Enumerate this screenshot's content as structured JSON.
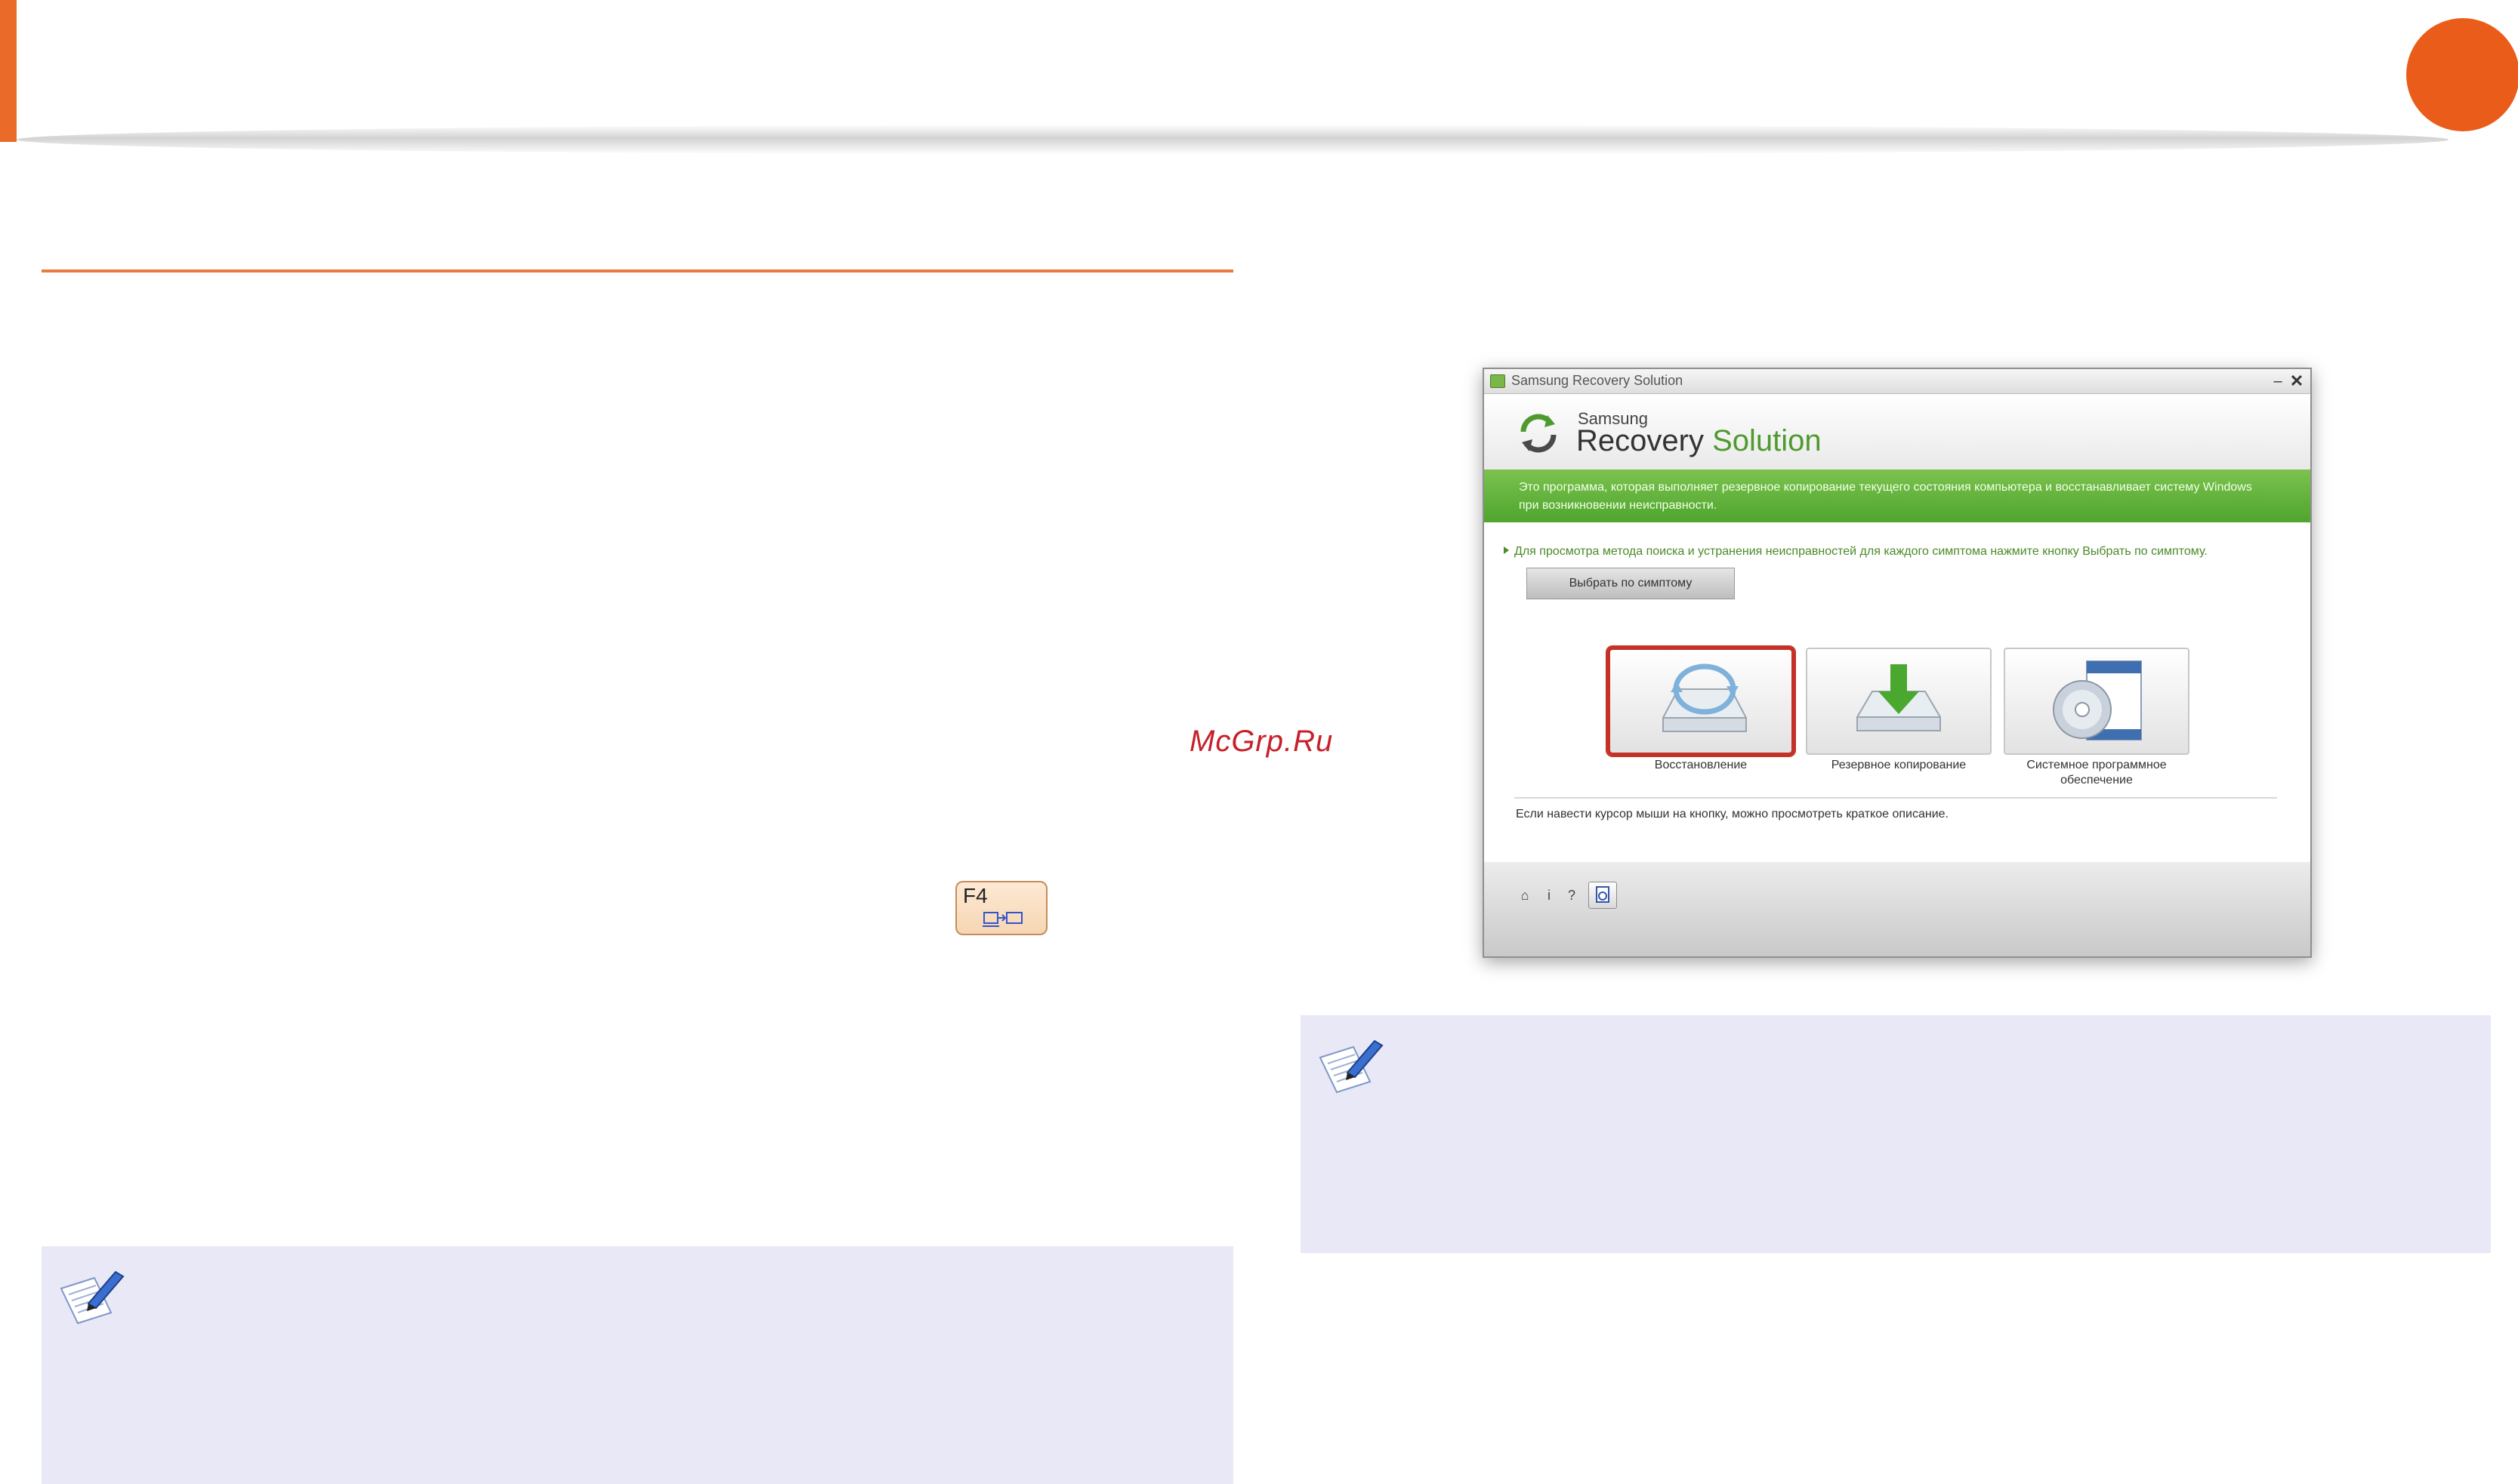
{
  "watermark": "McGrp.Ru",
  "f4_key": {
    "label": "F4"
  },
  "window": {
    "title": "Samsung Recovery Solution",
    "brand_small": "Samsung",
    "brand_word1": "Recovery",
    "brand_word2": "Solution",
    "intro": "Это программа, которая выполняет резервное копирование текущего состояния компьютера и восстанавливает систему Windows при возникновении неисправности.",
    "tip": "Для просмотра метода поиска и устранения неисправностей для каждого симптома нажмите кнопку Выбрать по симптому.",
    "symptom_button": "Выбрать по симптому",
    "tiles": [
      {
        "label": "Восстановление",
        "icon": "restore-drive-icon",
        "selected": true
      },
      {
        "label": "Резервное копирование",
        "icon": "backup-drive-icon",
        "selected": false
      },
      {
        "label": "Системное программное обеспечение",
        "icon": "system-software-icon",
        "selected": false
      }
    ],
    "hint": "Если навести курсор мыши на кнопку, можно просмотреть краткое описание.",
    "footer_buttons": [
      "home-icon",
      "info-icon",
      "help-icon",
      "document-icon"
    ]
  },
  "colors": {
    "accent": "#ea6a2a",
    "green": "#5aae35",
    "highlight": "#c43127",
    "note_bg": "#e8e8f6"
  }
}
